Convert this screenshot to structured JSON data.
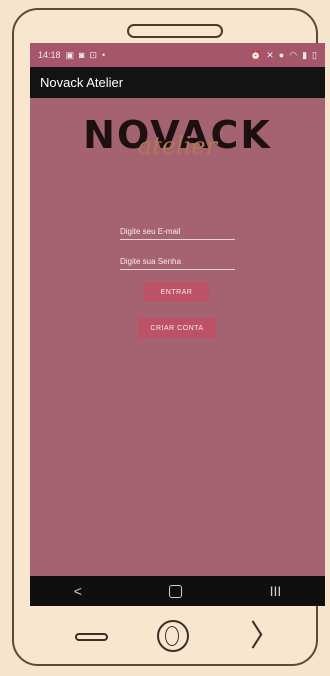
{
  "status_bar": {
    "time": "14:18",
    "left_icons": [
      "image-icon",
      "gallery-icon",
      "settings-icon",
      "dot-icon"
    ],
    "right_icons": [
      "alarm-icon",
      "mute-icon",
      "location-icon",
      "wifi-icon",
      "signal-icon",
      "battery-icon"
    ]
  },
  "app_bar": {
    "title": "Novack Atelier"
  },
  "logo": {
    "word": "NOVACK",
    "script": "atelier"
  },
  "login": {
    "email_placeholder": "Digite seu E-mail",
    "password_placeholder": "Digite sua Senha",
    "submit_label": "ENTRAR",
    "create_label": "CRIAR CONTA"
  },
  "nav_bar": {
    "back": "<",
    "home": "",
    "recents": "III"
  },
  "colors": {
    "screen_bg": "#a56270",
    "status_bg": "#a5566a",
    "appbar_bg": "#131313",
    "button_bg": "#bd5166",
    "frame_bg": "#f6e4cc"
  }
}
